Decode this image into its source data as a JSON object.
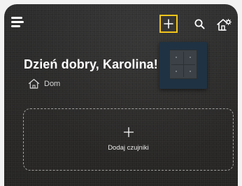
{
  "header": {
    "menu_icon": "hamburger-menu-icon",
    "add_icon": "plus-icon",
    "search_icon": "search-icon",
    "home_settings_icon": "home-settings-icon",
    "highlight_color": "#f3c61c"
  },
  "greeting": {
    "text": "Dzień dobry, Karolina!"
  },
  "home": {
    "icon": "home-icon",
    "label": "Dom"
  },
  "device_tile": {
    "icon": "light-switch-icon",
    "background_color": "#1f3243"
  },
  "add_sensors": {
    "icon": "plus-icon",
    "label": "Dodaj czujniki"
  }
}
